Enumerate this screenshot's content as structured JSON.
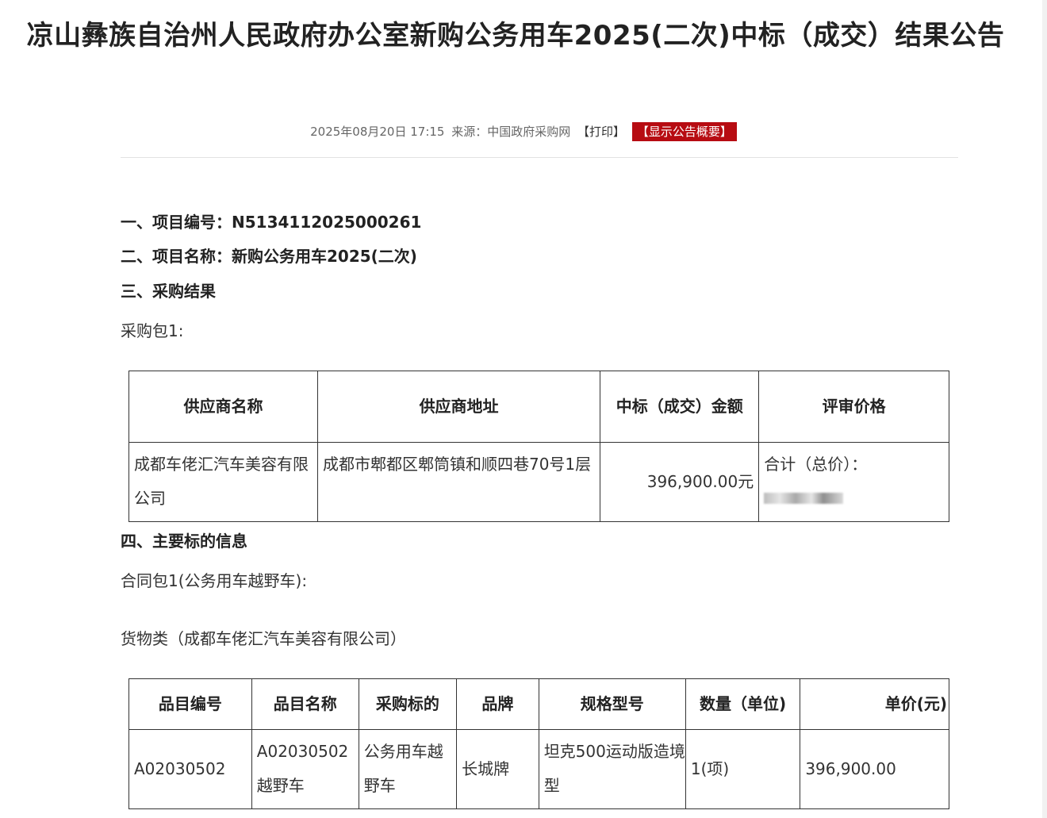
{
  "title": "凉山彝族自治州人民政府办公室新购公务用车2025(二次)中标（成交）结果公告",
  "meta": {
    "datetime": "2025年08月20日 17:15",
    "source": "来源：中国政府采购网",
    "print": "【打印】",
    "summary": "【显示公告概要】"
  },
  "sections": {
    "s1_label": "一、项目编号：",
    "s1_value": "N5134112025000261",
    "s2_label": "二、项目名称：",
    "s2_value": "新购公务用车2025(二次)",
    "s3": "三、采购结果",
    "package": "采购包1:",
    "s4": "四、主要标的信息",
    "contract": "合同包1(公务用车越野车):",
    "goods": "货物类（成都车佬汇汽车美容有限公司）"
  },
  "result_table": {
    "headers": [
      "供应商名称",
      "供应商地址",
      "中标（成交）金额",
      "评审价格"
    ],
    "row": {
      "supplier": "成都车佬汇汽车美容有限公司",
      "address": "成都市郫都区郫筒镇和顺四巷70号1层",
      "amount": "396,900.00元",
      "review_price": "合计（总价）："
    }
  },
  "item_table": {
    "headers": [
      "品目编号",
      "品目名称",
      "采购标的",
      "品牌",
      "规格型号",
      "数量（单位)",
      "单价(元)"
    ],
    "row": {
      "code": "A02030502",
      "name": "A02030502越野车",
      "subject": "公务用车越野车",
      "brand": "长城牌",
      "model": "坦克500运动版造境型",
      "qty": "1(项)",
      "price": "396,900.00"
    }
  }
}
